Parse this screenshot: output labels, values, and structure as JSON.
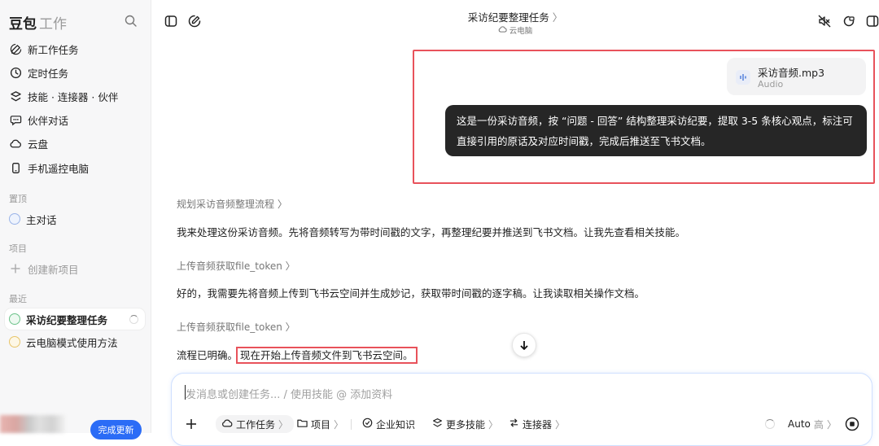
{
  "sidebar": {
    "brand": "豆包",
    "brand_sub": "工作",
    "nav": [
      {
        "label": "新工作任务",
        "icon": "edit-icon"
      },
      {
        "label": "定时任务",
        "icon": "clock-icon"
      },
      {
        "label": "技能 · 连接器 · 伙伴",
        "icon": "layers-icon"
      },
      {
        "label": "伙伴对话",
        "icon": "chat-icon"
      },
      {
        "label": "云盘",
        "icon": "cloud-icon"
      },
      {
        "label": "手机遥控电脑",
        "icon": "phone-icon"
      }
    ],
    "pinned_title": "置顶",
    "pinned": [
      {
        "label": "主对话"
      }
    ],
    "projects_title": "项目",
    "new_project": "创建新项目",
    "recent_title": "最近",
    "recent": [
      {
        "label": "采访纪要整理任务"
      },
      {
        "label": "云电脑模式使用方法"
      }
    ],
    "update_button": "完成更新"
  },
  "header": {
    "title": "采访纪要整理任务",
    "subtitle": "云电脑"
  },
  "conversation": {
    "attachment": {
      "name": "采访音频.mp3",
      "type": "Audio"
    },
    "user_message": "这是一份采访音频，按 “问题 - 回答” 结构整理采访纪要，提取 3-5 条核心观点，标注可直接引用的原话及对应时间戳，完成后推送至飞书文档。",
    "steps": [
      {
        "label": "规划采访音频整理流程",
        "text": "我来处理这份采访音频。先将音频转写为带时间戳的文字，再整理纪要并推送到飞书文档。让我先查看相关技能。"
      },
      {
        "label": "上传音频获取file_token",
        "text": "好的，我需要先将音频上传到飞书云空间并生成妙记，获取带时间戳的逐字稿。让我读取相关操作文档。"
      },
      {
        "label": "上传音频获取file_token",
        "text_a": "流程已明确。",
        "text_b": "现在开始上传音频文件到飞书云空间。"
      }
    ]
  },
  "composer": {
    "placeholder": "发消息或创建任务... / 使用技能 @ 添加资料",
    "tools": {
      "work_task": "工作任务",
      "project": "项目",
      "enterprise": "企业知识",
      "more_skills": "更多技能",
      "connectors": "连接器",
      "model": "Auto",
      "model_level": "高"
    }
  },
  "colors": {
    "accent": "#2b6cf6",
    "highlight": "#e8525b",
    "bubble": "#262626"
  }
}
